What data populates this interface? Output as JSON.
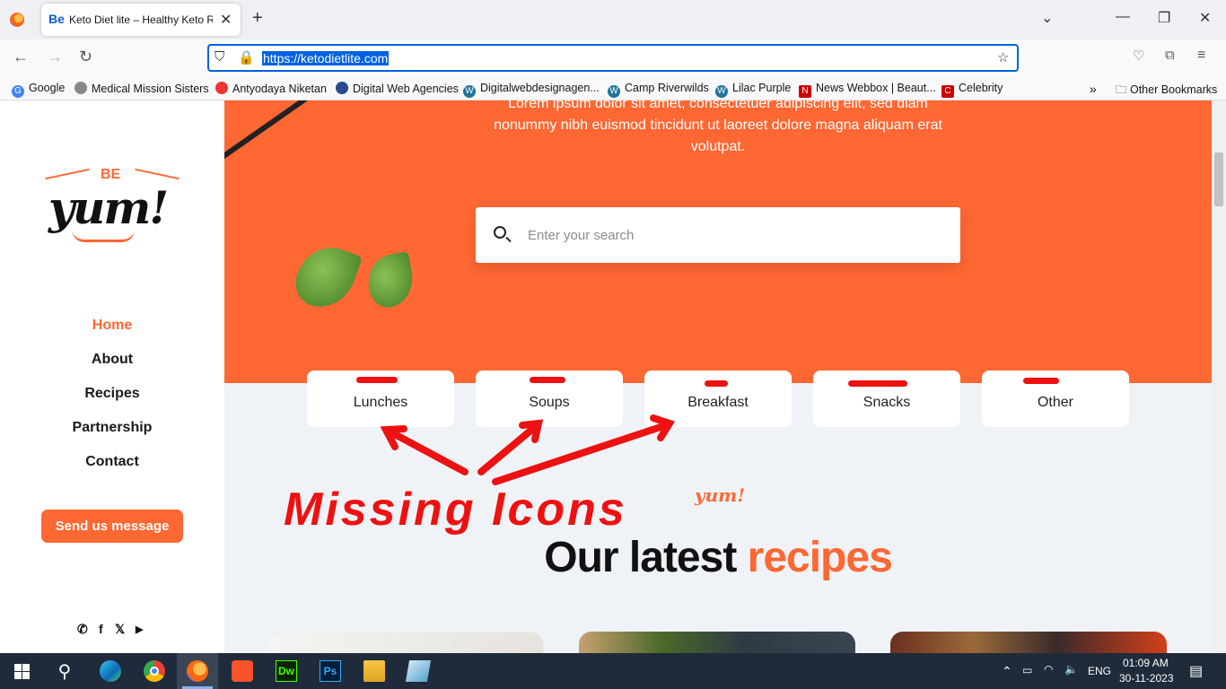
{
  "browser": {
    "tab_title": "Keto Diet lite – Healthy Keto Re",
    "tab_favicon": "Be",
    "url": "https://ketodietlite.com",
    "bookmarks": [
      "Google",
      "Medical Mission Sisters",
      "Antyodaya Niketan",
      "Digital Web Agencies",
      "Digitalwebdesignagen...",
      "Camp Riverwilds",
      "Lilac Purple",
      "News Webbox | Beaut...",
      "Celebrity"
    ],
    "other_bookmarks": "Other Bookmarks"
  },
  "sidebar": {
    "logo_top": "BE",
    "logo_main": "yum!",
    "nav": [
      "Home",
      "About",
      "Recipes",
      "Partnership",
      "Contact"
    ],
    "active_nav": "Home",
    "cta": "Send us message"
  },
  "hero": {
    "text_line1": "Lorem ipsum dolor sit amet, consectetuer adipiscing elit, sed diam",
    "text_line2": "nonummy nibh euismod tincidunt ut laoreet dolore magna aliquam erat",
    "text_line3": "volutpat.",
    "search_placeholder": "Enter your search"
  },
  "categories": [
    "Lunches",
    "Soups",
    "Breakfast",
    "Snacks",
    "Other"
  ],
  "annotation": "Missing Icons",
  "latest": {
    "tagline": "yum!",
    "title_dark": "Our latest",
    "title_accent": "recipes"
  },
  "taskbar": {
    "language": "ENG",
    "time": "01:09 AM",
    "date": "30-11-2023"
  },
  "colors": {
    "accent": "#ff6733",
    "annotation_red": "#ee1111",
    "url_highlight": "#0061e0"
  }
}
